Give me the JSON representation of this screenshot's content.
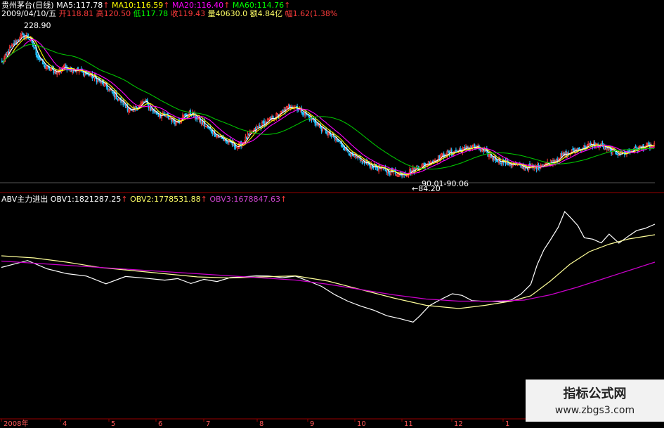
{
  "chart_data": [
    {
      "type": "candlestick",
      "header": {
        "symbol": "贵州茅台(日线)",
        "ma5": "MA5:117.78",
        "ma10": "MA10:116.59",
        "ma20": "MA20:116.40",
        "ma60": "MA60:114.76",
        "date": "2009/04/10/五",
        "open": "开118.81",
        "high": "高120.50",
        "low": "低117.78",
        "close": "收119.43",
        "volume": "量40630.0",
        "amount": "额4.84亿",
        "change": "幅1.62(1.38%"
      },
      "annotations": {
        "high_label": "228.90",
        "low_label": "←84.20",
        "range_label": "90.01-90.06"
      },
      "close_trend": [
        [
          0,
          195
        ],
        [
          6,
          206
        ],
        [
          12,
          214
        ],
        [
          18,
          220
        ],
        [
          24,
          219
        ],
        [
          28,
          212
        ],
        [
          32,
          202
        ],
        [
          38,
          193
        ],
        [
          44,
          189
        ],
        [
          50,
          187
        ],
        [
          56,
          192
        ],
        [
          62,
          190
        ],
        [
          70,
          188
        ],
        [
          80,
          184
        ],
        [
          92,
          176
        ],
        [
          102,
          166
        ],
        [
          110,
          158
        ],
        [
          118,
          150
        ],
        [
          124,
          156
        ],
        [
          130,
          160
        ],
        [
          136,
          152
        ],
        [
          142,
          148
        ],
        [
          150,
          146
        ],
        [
          158,
          141
        ],
        [
          164,
          146
        ],
        [
          172,
          149
        ],
        [
          178,
          144
        ],
        [
          186,
          136
        ],
        [
          196,
          128
        ],
        [
          206,
          122
        ],
        [
          214,
          118
        ],
        [
          220,
          124
        ],
        [
          226,
          131
        ],
        [
          234,
          137
        ],
        [
          240,
          141
        ],
        [
          248,
          146
        ],
        [
          256,
          151
        ],
        [
          262,
          156
        ],
        [
          268,
          154
        ],
        [
          276,
          148
        ],
        [
          284,
          141
        ],
        [
          290,
          135
        ],
        [
          298,
          129
        ],
        [
          306,
          122
        ],
        [
          312,
          116
        ],
        [
          318,
          110
        ],
        [
          324,
          106
        ],
        [
          330,
          103
        ],
        [
          336,
          101
        ],
        [
          344,
          98
        ],
        [
          350,
          96
        ],
        [
          356,
          95
        ],
        [
          360,
          93
        ],
        [
          366,
          94
        ],
        [
          374,
          97
        ],
        [
          382,
          101
        ],
        [
          390,
          105
        ],
        [
          398,
          109
        ],
        [
          404,
          112
        ],
        [
          412,
          114
        ],
        [
          420,
          116
        ],
        [
          428,
          118
        ],
        [
          434,
          116
        ],
        [
          440,
          112
        ],
        [
          448,
          107
        ],
        [
          456,
          104
        ],
        [
          464,
          102
        ],
        [
          472,
          100
        ],
        [
          480,
          99
        ],
        [
          486,
          100
        ],
        [
          490,
          102
        ],
        [
          496,
          103
        ],
        [
          502,
          106
        ],
        [
          508,
          110
        ],
        [
          514,
          112
        ],
        [
          520,
          115
        ],
        [
          526,
          117
        ],
        [
          532,
          119
        ],
        [
          538,
          120
        ],
        [
          544,
          119
        ],
        [
          550,
          116
        ],
        [
          556,
          113
        ],
        [
          562,
          112
        ],
        [
          568,
          113
        ],
        [
          574,
          116
        ],
        [
          580,
          118
        ],
        [
          586,
          119
        ],
        [
          592,
          119
        ]
      ],
      "ma_series": [
        {
          "name": "MA5",
          "color": "#ffffff"
        },
        {
          "name": "MA10",
          "color": "#ffff00"
        },
        {
          "name": "MA20",
          "color": "#ff00ff"
        },
        {
          "name": "MA60",
          "color": "#00c000"
        }
      ],
      "ylim": [
        80,
        235
      ]
    },
    {
      "type": "line",
      "indicator": "ABV主力进出",
      "series": [
        {
          "name": "OBV1:1821287.25",
          "color": "#ffffff",
          "values": [
            [
              0,
              0.705
            ],
            [
              0.04,
              0.735
            ],
            [
              0.07,
              0.7
            ],
            [
              0.1,
              0.675
            ],
            [
              0.13,
              0.66
            ],
            [
              0.16,
              0.63
            ],
            [
              0.19,
              0.66
            ],
            [
              0.22,
              0.655
            ],
            [
              0.25,
              0.64
            ],
            [
              0.27,
              0.655
            ],
            [
              0.29,
              0.625
            ],
            [
              0.31,
              0.65
            ],
            [
              0.33,
              0.64
            ],
            [
              0.35,
              0.66
            ],
            [
              0.37,
              0.655
            ],
            [
              0.39,
              0.665
            ],
            [
              0.41,
              0.665
            ],
            [
              0.43,
              0.66
            ],
            [
              0.45,
              0.665
            ],
            [
              0.47,
              0.64
            ],
            [
              0.49,
              0.61
            ],
            [
              0.51,
              0.58
            ],
            [
              0.53,
              0.545
            ],
            [
              0.55,
              0.52
            ],
            [
              0.57,
              0.5
            ],
            [
              0.59,
              0.48
            ],
            [
              0.61,
              0.46
            ],
            [
              0.63,
              0.445
            ],
            [
              0.64,
              0.47
            ],
            [
              0.655,
              0.52
            ],
            [
              0.67,
              0.55
            ],
            [
              0.69,
              0.58
            ],
            [
              0.705,
              0.575
            ],
            [
              0.72,
              0.55
            ],
            [
              0.735,
              0.54
            ],
            [
              0.75,
              0.545
            ],
            [
              0.765,
              0.545
            ],
            [
              0.78,
              0.55
            ],
            [
              0.795,
              0.575
            ],
            [
              0.81,
              0.62
            ],
            [
              0.82,
              0.72
            ],
            [
              0.83,
              0.79
            ],
            [
              0.84,
              0.835
            ],
            [
              0.852,
              0.895
            ],
            [
              0.862,
              0.965
            ],
            [
              0.872,
              0.94
            ],
            [
              0.882,
              0.9
            ],
            [
              0.892,
              0.85
            ],
            [
              0.905,
              0.84
            ],
            [
              0.918,
              0.82
            ],
            [
              0.93,
              0.86
            ],
            [
              0.945,
              0.82
            ],
            [
              0.96,
              0.85
            ],
            [
              0.972,
              0.875
            ],
            [
              0.985,
              0.89
            ],
            [
              1,
              0.91
            ]
          ]
        },
        {
          "name": "OBV2:1778531.88",
          "color": "#ffff99",
          "values": [
            [
              0,
              0.76
            ],
            [
              0.05,
              0.75
            ],
            [
              0.1,
              0.73
            ],
            [
              0.15,
              0.705
            ],
            [
              0.2,
              0.69
            ],
            [
              0.25,
              0.675
            ],
            [
              0.3,
              0.66
            ],
            [
              0.35,
              0.655
            ],
            [
              0.4,
              0.66
            ],
            [
              0.45,
              0.665
            ],
            [
              0.5,
              0.64
            ],
            [
              0.55,
              0.6
            ],
            [
              0.6,
              0.56
            ],
            [
              0.65,
              0.525
            ],
            [
              0.7,
              0.51
            ],
            [
              0.74,
              0.525
            ],
            [
              0.78,
              0.545
            ],
            [
              0.81,
              0.57
            ],
            [
              0.84,
              0.64
            ],
            [
              0.87,
              0.72
            ],
            [
              0.9,
              0.78
            ],
            [
              0.93,
              0.815
            ],
            [
              0.96,
              0.84
            ],
            [
              1,
              0.86
            ]
          ]
        },
        {
          "name": "OBV3:1678847.63",
          "color": "#cc00cc",
          "values": [
            [
              0,
              0.735
            ],
            [
              0.05,
              0.725
            ],
            [
              0.1,
              0.715
            ],
            [
              0.15,
              0.705
            ],
            [
              0.2,
              0.695
            ],
            [
              0.25,
              0.685
            ],
            [
              0.3,
              0.675
            ],
            [
              0.35,
              0.665
            ],
            [
              0.4,
              0.655
            ],
            [
              0.45,
              0.645
            ],
            [
              0.5,
              0.625
            ],
            [
              0.55,
              0.6
            ],
            [
              0.6,
              0.575
            ],
            [
              0.65,
              0.555
            ],
            [
              0.7,
              0.545
            ],
            [
              0.75,
              0.545
            ],
            [
              0.8,
              0.55
            ],
            [
              0.84,
              0.575
            ],
            [
              0.88,
              0.61
            ],
            [
              0.92,
              0.65
            ],
            [
              0.96,
              0.69
            ],
            [
              1,
              0.73
            ]
          ]
        }
      ]
    }
  ],
  "x_axis": {
    "labels": [
      "2008年",
      "4",
      "5",
      "6",
      "7",
      "8",
      "9",
      "10",
      "11",
      "12",
      "1"
    ]
  },
  "watermark": {
    "title": "指标公式网",
    "url": "www.zbgs3.com"
  },
  "colors": {
    "background": "#000000",
    "up": "#ff3b3b",
    "down": "#22c3ff",
    "ma5": "#ffffff",
    "ma10": "#ffff00",
    "ma20": "#ff00ff",
    "ma60": "#00c000",
    "divider": "#9a0000"
  }
}
